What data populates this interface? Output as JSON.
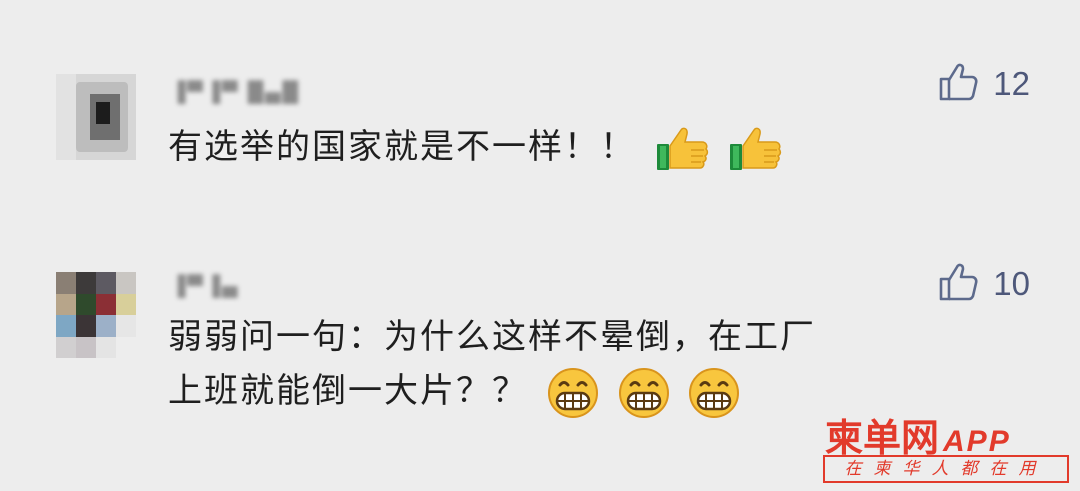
{
  "comments": [
    {
      "username": "▐▀▐▀ █▄█",
      "likes": "12",
      "text": "有选举的国家就是不一样！！",
      "emojis": [
        "thumbs-up",
        "thumbs-up"
      ]
    },
    {
      "username": "▐▀▐▄",
      "likes": "10",
      "text_line1": "弱弱问一句：为什么这样不晕倒，在工厂",
      "text_line2": "上班就能倒一大片？？",
      "emojis": [
        "grinning-face",
        "grinning-face",
        "grinning-face"
      ]
    }
  ],
  "watermark": {
    "brand": "柬单网",
    "app": "APP",
    "slogan": "在柬华人都在用"
  },
  "colors": {
    "background": "#ededed",
    "text": "#1f1f1f",
    "like": "#4e587a",
    "watermark": "#e23a2b"
  }
}
